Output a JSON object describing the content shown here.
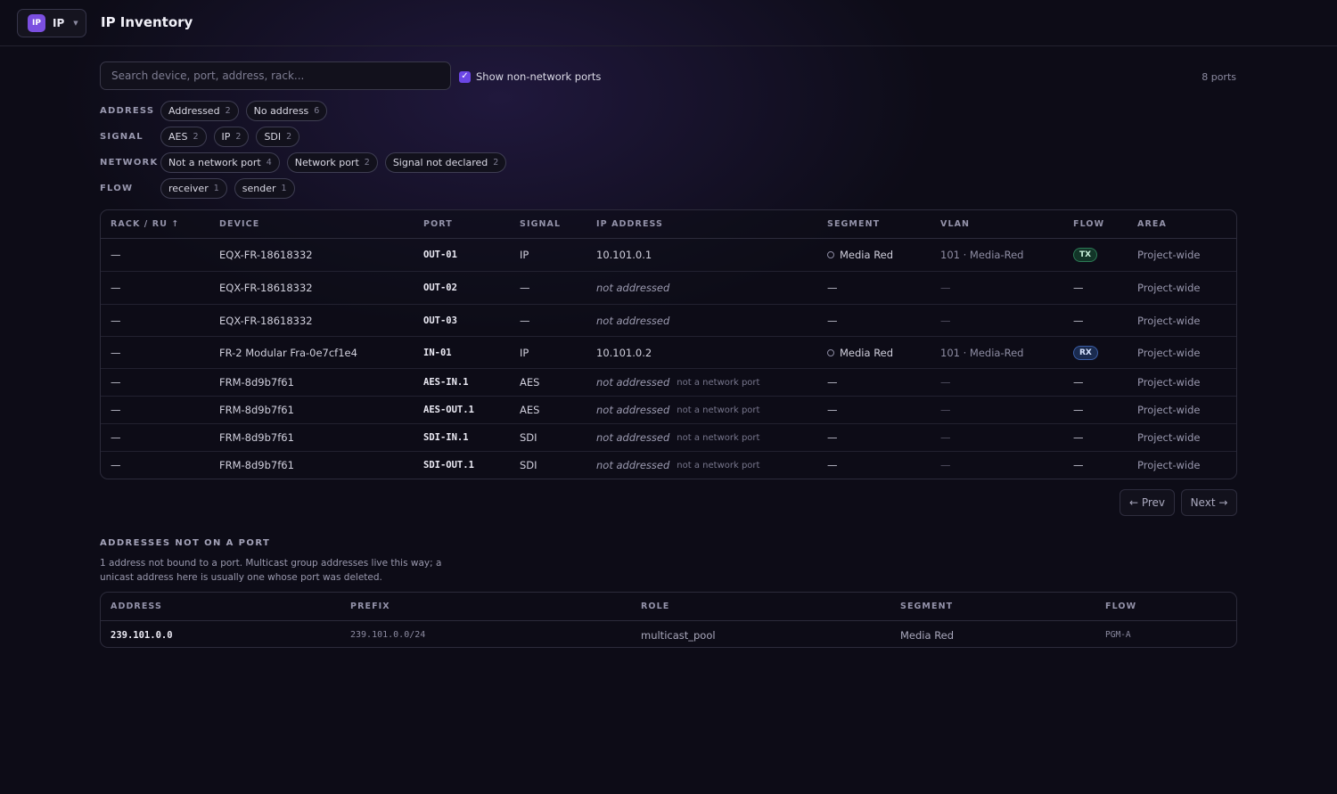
{
  "app": {
    "badge": "IP",
    "name": "IP",
    "title": "IP Inventory"
  },
  "search": {
    "placeholder": "Search device, port, address, rack..."
  },
  "toggle": {
    "label": "Show non-network ports",
    "checked": true
  },
  "port_count": "8 ports",
  "filters": [
    {
      "label": "ADDRESS",
      "chips": [
        {
          "label": "Addressed",
          "count": "2"
        },
        {
          "label": "No address",
          "count": "6"
        }
      ]
    },
    {
      "label": "SIGNAL",
      "chips": [
        {
          "label": "AES",
          "count": "2"
        },
        {
          "label": "IP",
          "count": "2"
        },
        {
          "label": "SDI",
          "count": "2"
        }
      ]
    },
    {
      "label": "NETWORK",
      "chips": [
        {
          "label": "Not a network port",
          "count": "4"
        },
        {
          "label": "Network port",
          "count": "2"
        },
        {
          "label": "Signal not declared",
          "count": "2"
        }
      ]
    },
    {
      "label": "FLOW",
      "chips": [
        {
          "label": "receiver",
          "count": "1"
        },
        {
          "label": "sender",
          "count": "1"
        }
      ]
    }
  ],
  "ports_table": {
    "headers": {
      "rack": "RACK / RU ↑",
      "device": "DEVICE",
      "port": "PORT",
      "signal": "SIGNAL",
      "ip": "IP ADDRESS",
      "segment": "SEGMENT",
      "vlan": "VLAN",
      "flow": "FLOW",
      "area": "AREA"
    },
    "rows": [
      {
        "rack": "—",
        "device": "EQX-FR-18618332",
        "port": "OUT-01",
        "signal": "IP",
        "ip": "10.101.0.1",
        "ip_note": "",
        "segment": "Media Red",
        "vlan": "101 · Media-Red",
        "flow": "TX",
        "area": "Project-wide"
      },
      {
        "rack": "—",
        "device": "EQX-FR-18618332",
        "port": "OUT-02",
        "signal": "—",
        "ip": "not addressed",
        "ip_note": "",
        "segment": "—",
        "vlan": "—",
        "flow": "—",
        "area": "Project-wide"
      },
      {
        "rack": "—",
        "device": "EQX-FR-18618332",
        "port": "OUT-03",
        "signal": "—",
        "ip": "not addressed",
        "ip_note": "",
        "segment": "—",
        "vlan": "—",
        "flow": "—",
        "area": "Project-wide"
      },
      {
        "rack": "—",
        "device": "FR-2 Modular Fra-0e7cf1e4",
        "port": "IN-01",
        "signal": "IP",
        "ip": "10.101.0.2",
        "ip_note": "",
        "segment": "Media Red",
        "vlan": "101 · Media-Red",
        "flow": "RX",
        "area": "Project-wide"
      },
      {
        "rack": "—",
        "device": "FRM-8d9b7f61",
        "port": "AES-IN.1",
        "signal": "AES",
        "ip": "not addressed",
        "ip_note": "not a network port",
        "segment": "—",
        "vlan": "—",
        "flow": "—",
        "area": "Project-wide"
      },
      {
        "rack": "—",
        "device": "FRM-8d9b7f61",
        "port": "AES-OUT.1",
        "signal": "AES",
        "ip": "not addressed",
        "ip_note": "not a network port",
        "segment": "—",
        "vlan": "—",
        "flow": "—",
        "area": "Project-wide"
      },
      {
        "rack": "—",
        "device": "FRM-8d9b7f61",
        "port": "SDI-IN.1",
        "signal": "SDI",
        "ip": "not addressed",
        "ip_note": "not a network port",
        "segment": "—",
        "vlan": "—",
        "flow": "—",
        "area": "Project-wide"
      },
      {
        "rack": "—",
        "device": "FRM-8d9b7f61",
        "port": "SDI-OUT.1",
        "signal": "SDI",
        "ip": "not addressed",
        "ip_note": "not a network port",
        "segment": "—",
        "vlan": "—",
        "flow": "—",
        "area": "Project-wide"
      }
    ]
  },
  "pager": {
    "prev": "← Prev",
    "next": "Next →"
  },
  "unbound": {
    "title": "ADDRESSES NOT ON A PORT",
    "description": "1 address not bound to a port. Multicast group addresses live this way; a unicast address here is usually one whose port was deleted.",
    "headers": {
      "address": "ADDRESS",
      "prefix": "PREFIX",
      "role": "ROLE",
      "segment": "SEGMENT",
      "flow": "FLOW"
    },
    "rows": [
      {
        "address": "239.101.0.0",
        "prefix": "239.101.0.0/24",
        "role": "multicast_pool",
        "segment": "Media Red",
        "flow": "PGM-A"
      }
    ]
  },
  "colors": {
    "accent": "#6b46e5",
    "tx": "#2c7a55",
    "rx": "#3b5ea6",
    "background": "#0d0c17"
  }
}
